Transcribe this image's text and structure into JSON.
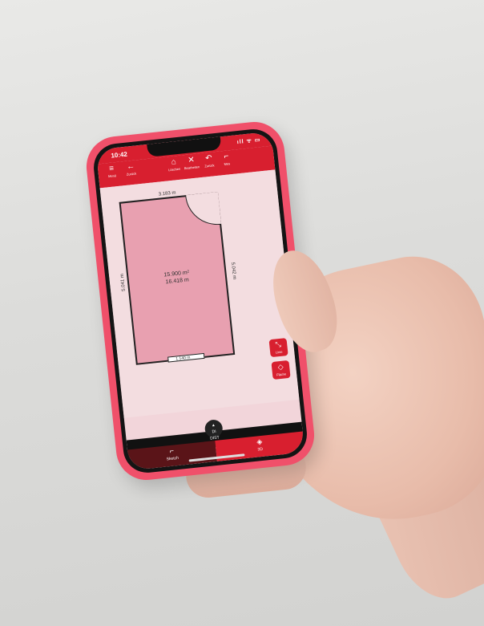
{
  "status_bar": {
    "time": "10:42",
    "icons": "ıll ᯤ ▭"
  },
  "toolbar": {
    "items": [
      {
        "label": "Menü",
        "icon": "≡"
      },
      {
        "label": "Zurück",
        "icon": "←"
      },
      {
        "label": "Löschen",
        "icon": "⌂"
      },
      {
        "label": "Bearbeiten",
        "icon": "✕"
      },
      {
        "label": "Zurück",
        "icon": "↶"
      },
      {
        "label": "Mes",
        "icon": "⌐"
      }
    ]
  },
  "floor_plan": {
    "top_dimension": "3.183 m",
    "left_dimension": "5.041 m",
    "right_dimension": "5.042 m",
    "bottom_dimension": "1.140 m",
    "area": "15.900 m²",
    "perimeter": "16.418 m"
  },
  "fab": {
    "line_label": "Linie",
    "area_label": "Fläche"
  },
  "logo_text": {
    "line1": "DI",
    "line2": "DIST"
  },
  "tabs": {
    "sketch": "Sketch",
    "three_d": "3D"
  },
  "colors": {
    "accent": "#d81f2f",
    "case": "#f0506a",
    "room_fill": "#e8a0b0"
  }
}
